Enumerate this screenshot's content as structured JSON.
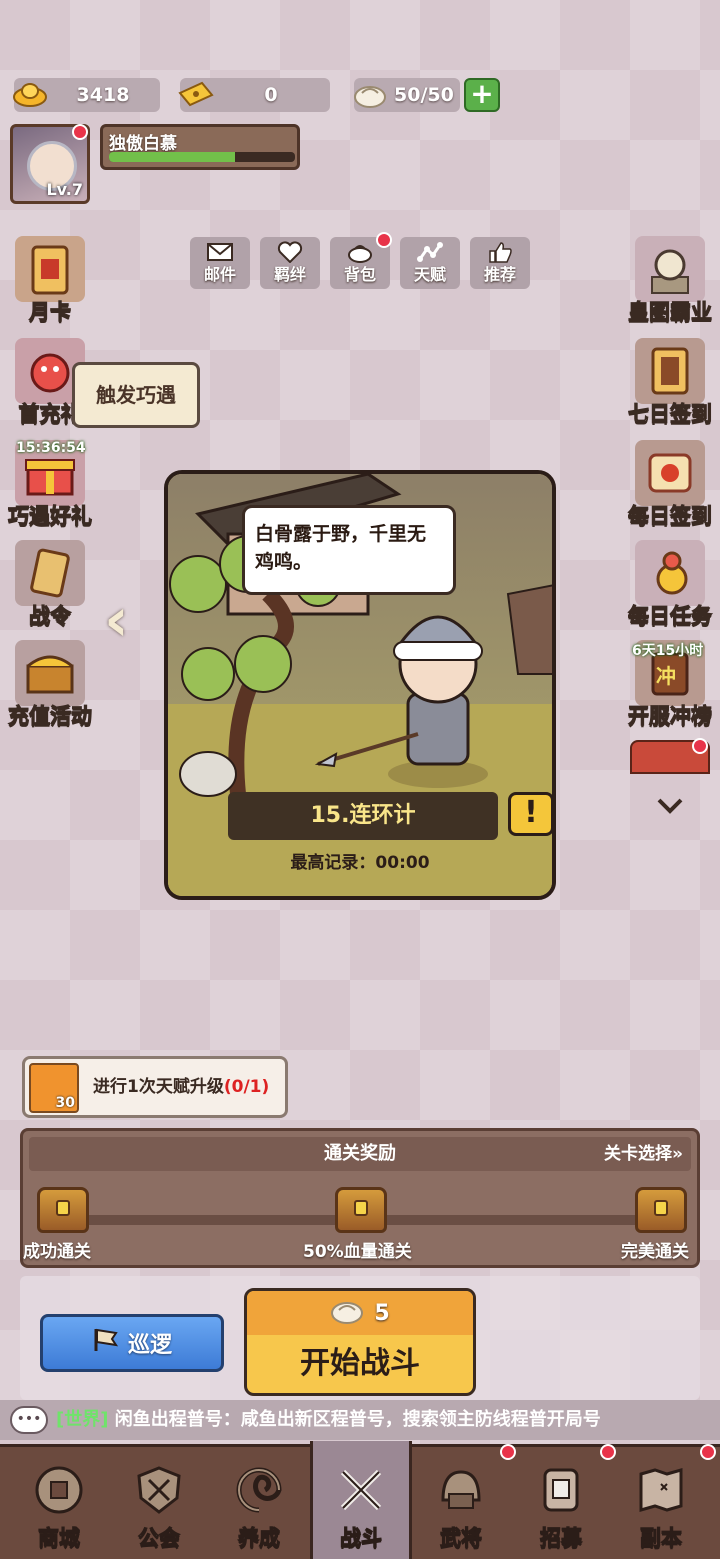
{
  "resources": {
    "gold": "3418",
    "ticket": "0",
    "stamina": "50/50",
    "plus": "+"
  },
  "player": {
    "name": "独傲白慕",
    "level": "Lv.7",
    "exp_fraction": 0.68
  },
  "top_menu": [
    {
      "label": "邮件",
      "icon": "mail-icon"
    },
    {
      "label": "羁绊",
      "icon": "heart-icon"
    },
    {
      "label": "背包",
      "icon": "bag-icon"
    },
    {
      "label": "天赋",
      "icon": "talent-icon"
    },
    {
      "label": "推荐",
      "icon": "thumbs-up-icon"
    }
  ],
  "left_side": [
    {
      "label": "月卡"
    },
    {
      "label": "首充礼"
    },
    {
      "label": "巧遇好礼",
      "timer": "15:36:54"
    },
    {
      "label": "战令"
    },
    {
      "label": "充值活动"
    }
  ],
  "tooltip": "触发巧遇",
  "right_side": [
    {
      "label": "皇图霸业"
    },
    {
      "label": "七日签到"
    },
    {
      "label": "每日签到"
    },
    {
      "label": "每日任务"
    },
    {
      "label": "开服冲榜",
      "timer": "6天15小时",
      "badge": "冲"
    }
  ],
  "stage": {
    "speech": "白骨露于野，千里无鸡鸣。",
    "title": "15.连环计",
    "record": "最高记录：00:00",
    "alert": "!"
  },
  "quest": {
    "text": "进行1次天赋升级",
    "progress": "(0/1)",
    "reward_count": "30"
  },
  "reward": {
    "title": "通关奖励",
    "select": "关卡选择»",
    "milestones": [
      "成功通关",
      "50%血量通关",
      "完美通关"
    ]
  },
  "actions": {
    "patrol": "巡逻",
    "start_cost": "5",
    "start": "开始战斗"
  },
  "chat": {
    "channel": "[世界]",
    "message": "闲鱼出程普号：咸鱼出新区程普号，搜索领主防线程普开局号"
  },
  "nav": [
    {
      "label": "商城"
    },
    {
      "label": "公会"
    },
    {
      "label": "养成"
    },
    {
      "label": "战斗"
    },
    {
      "label": "武将"
    },
    {
      "label": "招募"
    },
    {
      "label": "副本"
    }
  ]
}
